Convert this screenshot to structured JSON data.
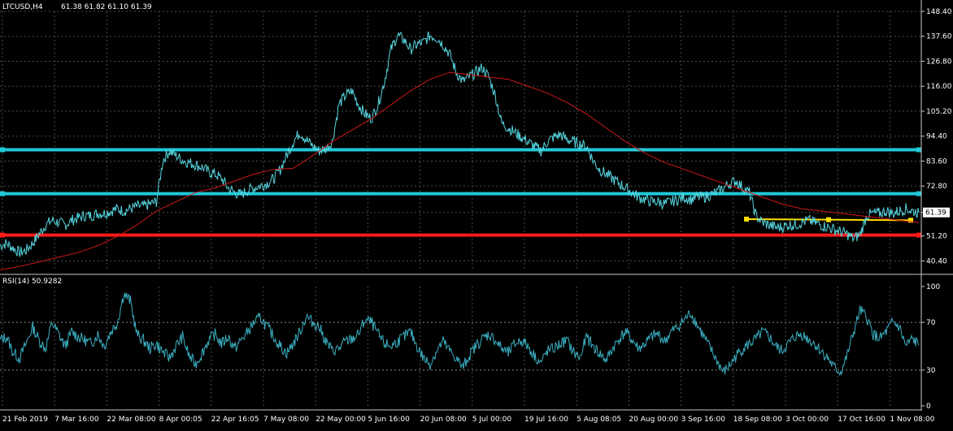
{
  "header": {
    "symbol_label": "LTCUSD,H4",
    "ohlc_text": "61.38 61.82 61.10 61.39"
  },
  "current_price_label": "61.39",
  "colors": {
    "background": "#000000",
    "grid": "#4a4a4a",
    "axis": "#c8c8c8",
    "text": "#ffffff",
    "price_series": "#56d6e0",
    "moving_average": "#d01818",
    "level_lines": "#20c8d8",
    "support_line": "#ff1a1a",
    "yellow_line": "#ffe000",
    "rsi_series": "#3aaec0",
    "rsi_levels": "#8a8a8a",
    "price_tag_bg": "#000000"
  },
  "chart_data": [
    {
      "type": "line",
      "title": "LTCUSD,H4",
      "ylim": [
        36.0,
        148.4
      ],
      "yticks": [
        "148.40",
        "137.60",
        "126.80",
        "116.00",
        "105.20",
        "94.40",
        "83.60",
        "72.80",
        "61.39",
        "51.20",
        "40.40"
      ],
      "x_tick_labels": [
        "21 Feb 2019",
        "7 Mar 16:00",
        "22 Mar 08:00",
        "8 Apr 00:05",
        "22 Apr 16:05",
        "7 May 08:00",
        "22 May 00:00",
        "5 Jun 16:00",
        "20 Jun 08:00",
        "5 Jul 00:00",
        "19 Jul 16:00",
        "5 Aug 08:05",
        "20 Aug 00:00",
        "3 Sep 16:00",
        "18 Sep 08:00",
        "3 Oct 00:00",
        "17 Oct 16:00",
        "1 Nov 08:00"
      ],
      "grid": true,
      "series": [
        {
          "name": "",
          "color": "price_series",
          "values": [
            47,
            48,
            46,
            44,
            45,
            48,
            52,
            56,
            58,
            57,
            56,
            58,
            59,
            60,
            60,
            61,
            61,
            62,
            63,
            62,
            63,
            64,
            64,
            65,
            66,
            84,
            88,
            86,
            84,
            83,
            82,
            81,
            79,
            78,
            76,
            72,
            70,
            69,
            71,
            72,
            73,
            74,
            76,
            80,
            86,
            92,
            96,
            93,
            90,
            88,
            89,
            92,
            108,
            112,
            114,
            108,
            104,
            102,
            108,
            118,
            132,
            138,
            136,
            132,
            134,
            135,
            138,
            137,
            134,
            130,
            122,
            118,
            120,
            122,
            124,
            120,
            112,
            100,
            98,
            96,
            94,
            92,
            90,
            88,
            92,
            94,
            95,
            93,
            92,
            91,
            90,
            84,
            80,
            78,
            76,
            74,
            72,
            70,
            68,
            67,
            66,
            66,
            65,
            66,
            67,
            68,
            67,
            68,
            68,
            69,
            70,
            72,
            74,
            75,
            72,
            70,
            60,
            57,
            56,
            55,
            55,
            56,
            56,
            57,
            58,
            57,
            56,
            55,
            54,
            53,
            52,
            50,
            52,
            60,
            61,
            61,
            62,
            61,
            62,
            63,
            62,
            61.39
          ]
        },
        {
          "name": "",
          "color": "moving_average",
          "values": [
            36.5,
            38,
            40,
            42,
            44,
            47,
            51,
            56,
            62,
            66,
            70,
            72,
            75,
            78,
            80,
            80.5,
            86,
            92,
            97,
            102,
            108,
            114,
            119,
            122,
            121,
            120,
            119,
            116,
            113,
            109,
            104,
            98,
            92,
            87,
            83,
            80,
            77,
            74,
            71,
            68,
            65,
            63,
            62,
            61,
            60,
            59,
            58,
            57
          ]
        }
      ],
      "reference_lines": [
        {
          "value": 88.5,
          "color": "level_lines"
        },
        {
          "value": 69.5,
          "color": "level_lines"
        },
        {
          "value": 51.6,
          "color": "support_line"
        }
      ],
      "trend_segment": {
        "start_value": 58.5,
        "end_value": 58.0,
        "color": "yellow_line"
      }
    },
    {
      "type": "line",
      "title": "RSI(14) 50.9282",
      "ylim": [
        0,
        100
      ],
      "yticks": [
        "100",
        "70",
        "30",
        "0"
      ],
      "series": [
        {
          "name": "RSI(14)",
          "color": "rsi_series",
          "values": [
            55,
            58,
            45,
            40,
            52,
            66,
            55,
            48,
            70,
            60,
            50,
            62,
            58,
            55,
            52,
            60,
            50,
            62,
            70,
            94,
            88,
            60,
            55,
            48,
            52,
            45,
            40,
            50,
            58,
            42,
            35,
            44,
            55,
            60,
            52,
            58,
            48,
            55,
            62,
            70,
            74,
            66,
            58,
            50,
            44,
            52,
            62,
            75,
            70,
            66,
            54,
            46,
            48,
            54,
            56,
            60,
            72,
            70,
            60,
            52,
            50,
            54,
            58,
            62,
            50,
            40,
            35,
            46,
            54,
            46,
            40,
            32,
            42,
            50,
            56,
            60,
            55,
            48,
            44,
            52,
            55,
            50,
            42,
            36,
            46,
            48,
            52,
            55,
            45,
            40,
            58,
            50,
            44,
            38,
            48,
            56,
            62,
            55,
            48,
            52,
            58,
            60,
            54,
            62,
            66,
            72,
            78,
            68,
            58,
            48,
            38,
            28,
            34,
            42,
            48,
            52,
            56,
            62,
            58,
            50,
            46,
            52,
            58,
            60,
            56,
            52,
            46,
            40,
            32,
            28,
            42,
            62,
            80,
            74,
            60,
            56,
            62,
            70,
            66,
            50,
            56,
            50.9
          ]
        }
      ],
      "reference_lines": [
        {
          "value": 70,
          "color": "rsi_levels"
        },
        {
          "value": 30,
          "color": "rsi_levels"
        }
      ]
    }
  ]
}
